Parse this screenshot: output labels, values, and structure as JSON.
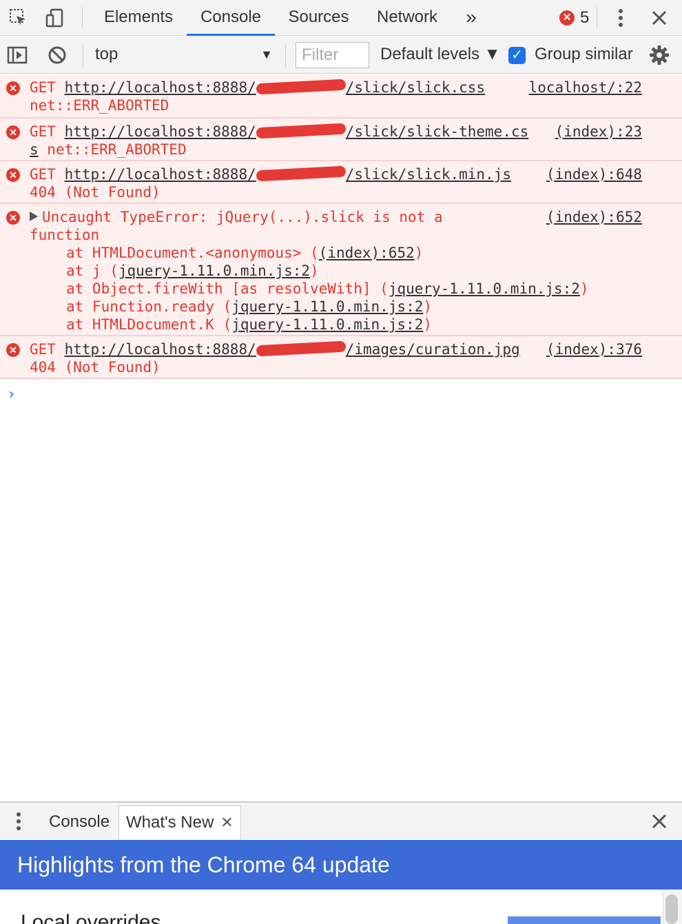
{
  "tabbar": {
    "tabs": [
      {
        "label": "Elements"
      },
      {
        "label": "Console"
      },
      {
        "label": "Sources"
      },
      {
        "label": "Network"
      }
    ],
    "more_label": "»",
    "error_count": "5"
  },
  "toolbar": {
    "context": "top",
    "filter_placeholder": "Filter",
    "levels_label": "Default levels ▼",
    "group_similar_label": "Group similar",
    "group_similar_checked": true
  },
  "messages": [
    {
      "method": "GET",
      "url_prefix": "http://localhost:8888/",
      "url_suffix": "/slick/slick.css",
      "line2": "net::ERR_ABORTED",
      "source": "localhost/:22"
    },
    {
      "method": "GET",
      "url_prefix": "http://localhost:8888/",
      "url_suffix": "/slick/slick-theme.cs",
      "line2_link": "s",
      "line2": " net::ERR_ABORTED",
      "source": "(index):23"
    },
    {
      "method": "GET",
      "url_prefix": "http://localhost:8888/",
      "url_suffix": "/slick/slick.min.js",
      "line2": "404 (Not Found)",
      "source": "(index):648"
    },
    {
      "line1": "Uncaught TypeError: jQuery(...).slick is not a",
      "line2": "function",
      "source": "(index):652",
      "stack": [
        {
          "prefix": "at HTMLDocument.<anonymous> (",
          "link": "(index):652",
          "suffix": ")"
        },
        {
          "prefix": "at j (",
          "link": "jquery-1.11.0.min.js:2",
          "suffix": ")"
        },
        {
          "prefix": "at Object.fireWith [as resolveWith] (",
          "link": "jquery-1.11.0.min.js:2",
          "suffix": ")"
        },
        {
          "prefix": "at Function.ready (",
          "link": "jquery-1.11.0.min.js:2",
          "suffix": ")"
        },
        {
          "prefix": "at HTMLDocument.K (",
          "link": "jquery-1.11.0.min.js:2",
          "suffix": ")"
        }
      ]
    },
    {
      "method": "GET",
      "url_prefix": "http://localhost:8888/",
      "url_suffix": "/images/curation.jpg",
      "line2": "404 (Not Found)",
      "source": "(index):376"
    }
  ],
  "drawer": {
    "tabs": [
      {
        "label": "Console"
      },
      {
        "label": "What's New"
      }
    ],
    "banner": "Highlights from the Chrome 64 update",
    "section_title": "Local overrides"
  },
  "colors": {
    "error_red": "#e0392f",
    "accent_blue": "#1a73e8",
    "banner_blue": "#3c6ad6",
    "error_bg": "#fff0f0"
  }
}
